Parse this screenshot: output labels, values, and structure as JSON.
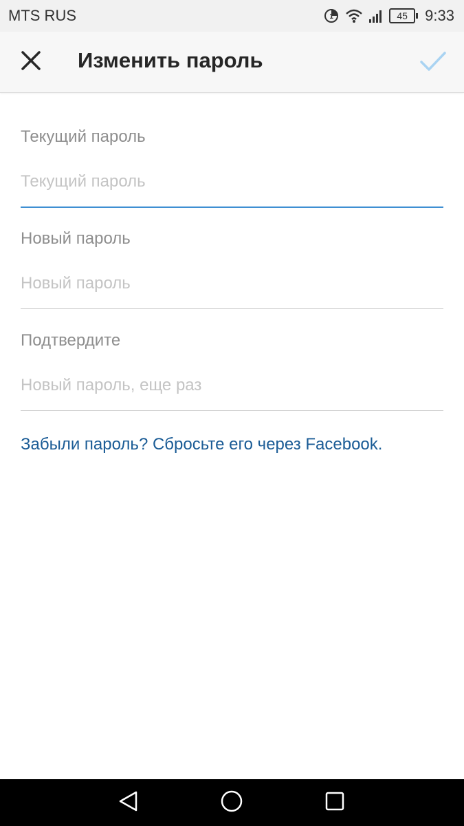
{
  "status_bar": {
    "carrier": "MTS RUS",
    "battery_level": "45",
    "time": "9:33",
    "icons": [
      "data-saver-icon",
      "wifi-icon",
      "signal-icon",
      "battery-icon"
    ]
  },
  "toolbar": {
    "title": "Изменить пароль",
    "close_icon": "close-icon",
    "confirm_icon": "checkmark-icon"
  },
  "form": {
    "current_password": {
      "label": "Текущий пароль",
      "placeholder": "Текущий пароль",
      "value": ""
    },
    "new_password": {
      "label": "Новый пароль",
      "placeholder": "Новый пароль",
      "value": ""
    },
    "confirm_password": {
      "label": "Подтвердите",
      "placeholder": "Новый пароль, еще раз",
      "value": ""
    },
    "forgot_link": "Забыли пароль? Сбросьте его через Facebook."
  },
  "nav_bar": {
    "icons": [
      "back-icon",
      "home-icon",
      "recents-icon"
    ]
  },
  "colors": {
    "accent": "#3f8fd2",
    "link": "#1b5c96",
    "confirm_disabled": "#a9d3f2",
    "label": "#8e8e8e",
    "placeholder": "#c4c4c4"
  }
}
